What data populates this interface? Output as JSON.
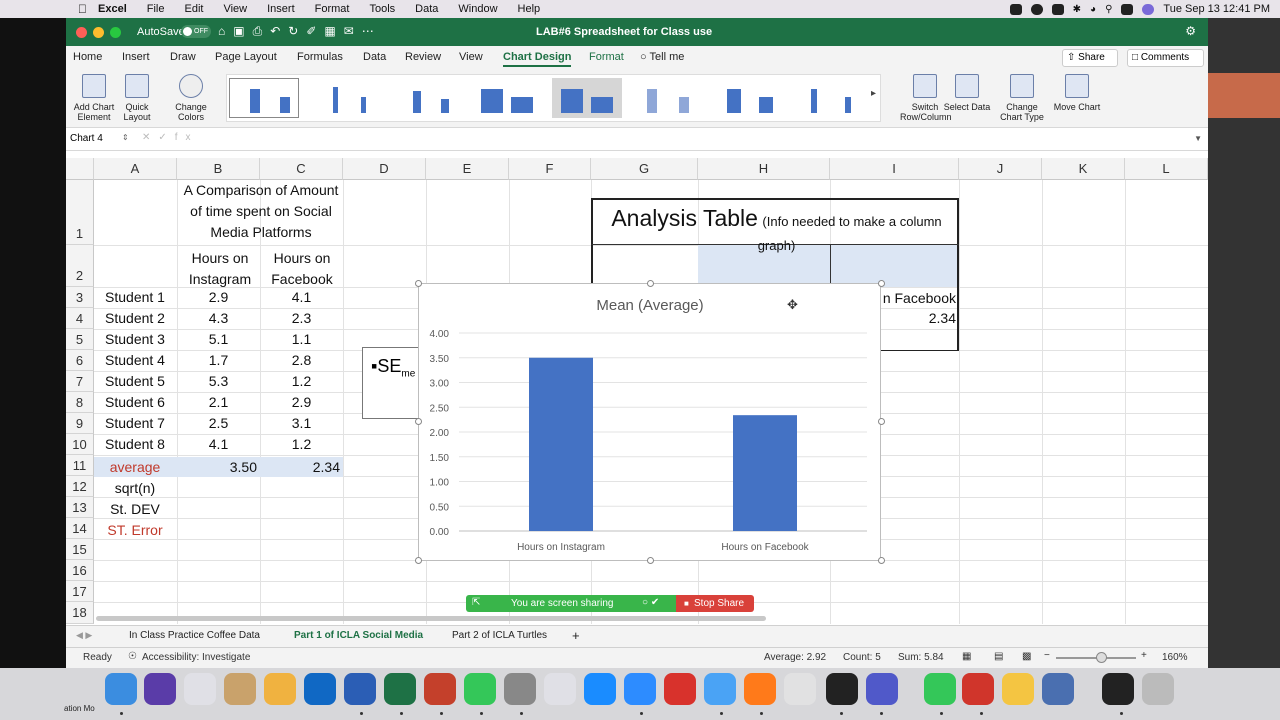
{
  "menubar": {
    "items": [
      "Excel",
      "File",
      "Edit",
      "View",
      "Insert",
      "Format",
      "Tools",
      "Data",
      "Window",
      "Help"
    ],
    "datetime": "Tue Sep 13  12:41 PM"
  },
  "titlebar": {
    "autosave": "AutoSave",
    "toggle": "OFF",
    "doc_title": "LAB#6 Spreadsheet for Class use"
  },
  "ribbon_tabs": [
    "Home",
    "Insert",
    "Draw",
    "Page Layout",
    "Formulas",
    "Data",
    "Review",
    "View",
    "Chart Design",
    "Format",
    "Tell me"
  ],
  "share_label": "Share",
  "comments_label": "Comments",
  "ribbon_buttons": {
    "add_chart_element": "Add Chart Element",
    "quick_layout": "Quick Layout",
    "change_colors": "Change Colors",
    "switch_row_column": "Switch Row/Column",
    "select_data": "Select Data",
    "change_chart_type": "Change Chart Type",
    "move_chart": "Move Chart"
  },
  "formula_bar": {
    "name_box": "Chart 4",
    "fx": "fx"
  },
  "columns": [
    "A",
    "B",
    "C",
    "D",
    "E",
    "F",
    "G",
    "H",
    "I",
    "J",
    "K",
    "L"
  ],
  "rows": [
    "1",
    "2",
    "3",
    "4",
    "5",
    "6",
    "7",
    "8",
    "9",
    "10",
    "11",
    "12",
    "13",
    "14",
    "15",
    "16",
    "17",
    "18"
  ],
  "table": {
    "title": "A Comparison of Amount of time spent on Social Media Platforms",
    "header_b": "Hours on Instagram",
    "header_c": "Hours on Facebook",
    "students": [
      {
        "name": "Student 1",
        "instagram": "2.9",
        "facebook": "4.1"
      },
      {
        "name": "Student 2",
        "instagram": "4.3",
        "facebook": "2.3"
      },
      {
        "name": "Student 3",
        "instagram": "5.1",
        "facebook": "1.1"
      },
      {
        "name": "Student 4",
        "instagram": "1.7",
        "facebook": "2.8"
      },
      {
        "name": "Student 5",
        "instagram": "5.3",
        "facebook": "1.2"
      },
      {
        "name": "Student 6",
        "instagram": "2.1",
        "facebook": "2.9"
      },
      {
        "name": "Student 7",
        "instagram": "2.5",
        "facebook": "3.1"
      },
      {
        "name": "Student 8",
        "instagram": "4.1",
        "facebook": "1.2"
      }
    ],
    "average_label": "average",
    "average_b": "3.50",
    "average_c": "2.34",
    "sqrt_label": "sqrt(n)",
    "stdev_label": "St. DEV",
    "sterror_label": "ST. Error"
  },
  "analysis": {
    "title": "Analysis Table",
    "subtitle": "(Info needed to make a column graph)",
    "facebook_header_partial": "n Facebook",
    "facebook_value": "2.34"
  },
  "textbox": "SE",
  "textbox_sub": "me",
  "chart_data": {
    "type": "bar",
    "title": "Mean (Average)",
    "categories": [
      "Hours on Instagram",
      "Hours on Facebook"
    ],
    "values": [
      3.5,
      2.34
    ],
    "ylim": [
      0,
      4
    ],
    "yticks": [
      "0.00",
      "0.50",
      "1.00",
      "1.50",
      "2.00",
      "2.50",
      "3.00",
      "3.50",
      "4.00"
    ],
    "xlabel": "",
    "ylabel": "",
    "color": "#4472c4",
    "grid": true
  },
  "screen_share": {
    "message": "You are screen sharing",
    "stop": "Stop Share"
  },
  "sheet_tabs": [
    "In Class Practice Coffee Data",
    "Part 1 of ICLA Social Media",
    "Part 2 of ICLA Turtles"
  ],
  "status": {
    "ready": "Ready",
    "accessibility": "Accessibility: Investigate",
    "average": "Average: 2.92",
    "count": "Count: 5",
    "sum": "Sum: 5.84",
    "zoom": "160%"
  },
  "dock_label": "ation Mo"
}
